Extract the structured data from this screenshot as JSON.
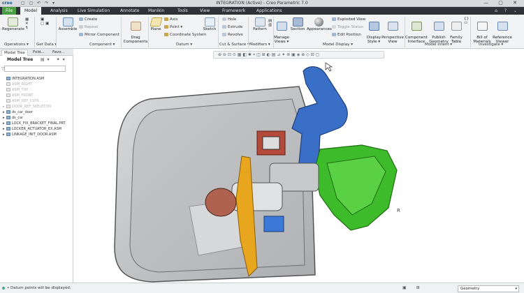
{
  "title_bar": {
    "logo": "creo",
    "title": "INTEGRATION (Active) - Creo Parametric 7.0",
    "quick_access": "▢ ▢ ↶ ↷ ▾",
    "window_controls": "— ▢ ✕"
  },
  "tabs": {
    "file": "File",
    "model": "Model",
    "analysis": "Analysis",
    "live_sim": "Live Simulation",
    "annotate": "Annotate",
    "manikin": "Manikin",
    "tools": "Tools",
    "view": "View",
    "framework": "Framework",
    "applications": "Applications",
    "right_icons": "⌂ ? ⌄"
  },
  "ribbon": {
    "regenerate": "Regenerate",
    "operations": "Operations ▾",
    "get_data": "Get Data ▾",
    "assemble": "Assemble",
    "create": "Create",
    "repeat": "Repeat",
    "mirror": "Mirror Component",
    "component": "Component ▾",
    "drag": "Drag\nComponents",
    "plane": "Plane",
    "axis": "Axis",
    "point": "Point ▾",
    "csys": "Coordinate System",
    "sketch": "Sketch",
    "datum": "Datum ▾",
    "hole": "Hole",
    "extrude": "Extrude",
    "revolve": "Revolve",
    "cut_surface": "Cut & Surface ▾",
    "pattern": "Pattern",
    "modifiers": "Modifiers ▾",
    "manage_views": "Manage\nViews ▾",
    "section": "Section",
    "appearances": "Appearances",
    "exploded": "Exploded View",
    "toggle_status": "Toggle Status",
    "edit_position": "Edit Position",
    "display_style": "Display\nStyle ▾",
    "perspective": "Perspective\nView",
    "model_display": "Model Display ▾",
    "comp_interface": "Component\nInterface",
    "publish_geom": "Publish\nGeometry",
    "family_table": "Family\nTable",
    "model_intent": "Model Intent ▾",
    "bill_materials": "Bill of\nMaterials",
    "reference_viewer": "Reference\nViewer",
    "investigate": "Investigate ▾"
  },
  "panel": {
    "tabs": [
      "Model Tree",
      "Fold...",
      "Favo..."
    ],
    "header": "Model Tree",
    "tree": [
      {
        "label": "INTEGRATION.ASM",
        "dim": false,
        "arrow": ""
      },
      {
        "label": "ASM_RIGHT",
        "dim": true,
        "arrow": ""
      },
      {
        "label": "ASM_TOP",
        "dim": true,
        "arrow": ""
      },
      {
        "label": "ASM_FRONT",
        "dim": true,
        "arrow": ""
      },
      {
        "label": "ASM_DEF_CSYS",
        "dim": true,
        "arrow": ""
      },
      {
        "label": "DOOR_REF_SKELETON",
        "dim": true,
        "arrow": "▸"
      },
      {
        "label": "ds_car_door",
        "dim": false,
        "arrow": "▸"
      },
      {
        "label": "ds_car",
        "dim": false,
        "arrow": "▸"
      },
      {
        "label": "LOCK_FIX_BRACKET_FINAL.PRT",
        "dim": false,
        "arrow": "▸"
      },
      {
        "label": "LOCKER_ACTUATOR_EX.ASM",
        "dim": false,
        "arrow": "▸"
      },
      {
        "label": "LINKAGE_INIT_DOOR.ASM",
        "dim": false,
        "arrow": "▸"
      }
    ]
  },
  "graphics_toolbar": "⊕ ⊖ ⊡ ⊙ ▦ ◧ ✱ ⌖ ◫ ⊞ ◐ ▤ ⊿ ✦ ⊚ ▣ ◈ ⊕ ◇ ⊟ ▢",
  "viewport": {
    "label": "R"
  },
  "status": {
    "message": "• Datum points will be displayed.",
    "icons": "▣ ⊞",
    "selector": "Geometry"
  },
  "colors": {
    "accent": "#4b9e44",
    "ribbon_bg": "#f2f3f5",
    "tab_bar": "#2f3338",
    "blue_part": "#3a6fc7",
    "green_part": "#3dbb2a",
    "orange_part": "#e8a51e",
    "red_part": "#b44a3a"
  }
}
